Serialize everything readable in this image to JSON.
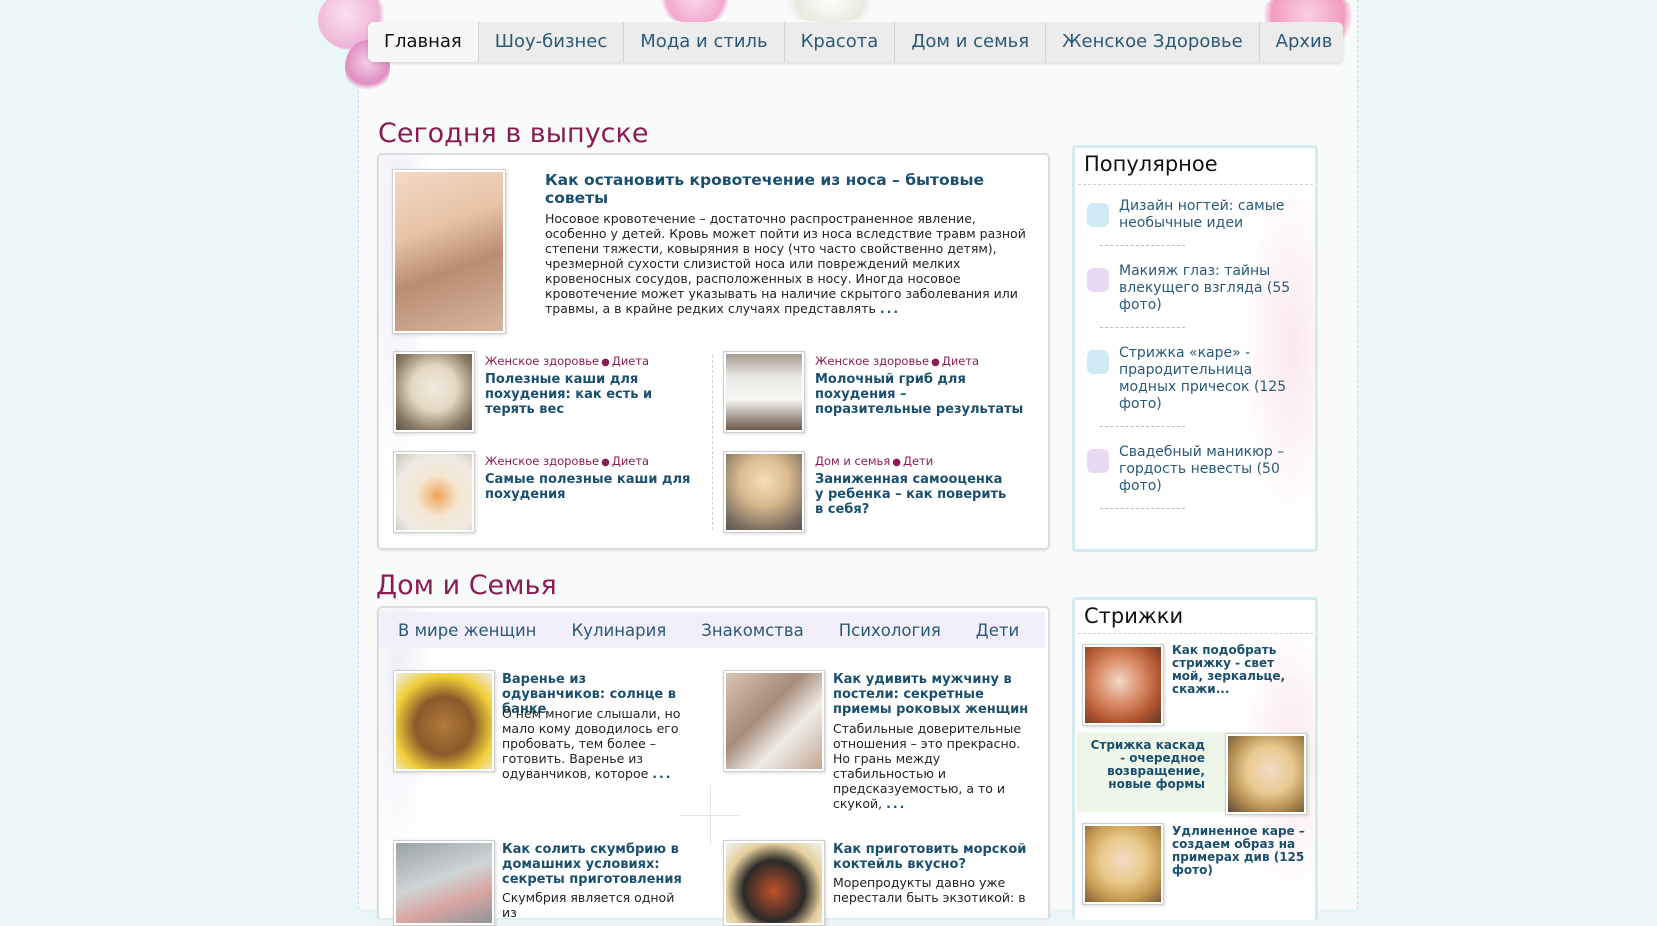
{
  "nav": {
    "items": [
      "Главная",
      "Шоу-бизнес",
      "Мода и стиль",
      "Красота",
      "Дом и семья",
      "Женское Здоровье",
      "Архив"
    ],
    "active": 0
  },
  "today": {
    "heading": "Сегодня в выпуске",
    "lead": {
      "title": "Как остановить кровотечение из носа – бытовые советы",
      "text": "Носовое кровотечение – достаточно распространенное явление, особенно у детей. Кровь может пойти из носа вследствие травм разной степени тяжести, ковыряния в носу (что часто свойственно детям), чрезмерной сухости слизистой носа или повреждений мелких кровеносных сосудов, расположенных в носу. Иногда носовое кровотечение может указывать на наличие скрытого заболевания или травмы, а в крайне редких случаях представлять",
      "more": "..."
    },
    "articles": [
      {
        "cat1": "Женское здоровье",
        "cat2": "Диета",
        "title": "Полезные каши для похудения: как есть и терять вес"
      },
      {
        "cat1": "Женское здоровье",
        "cat2": "Диета",
        "title": "Молочный гриб для похудения – поразительные результаты"
      },
      {
        "cat1": "Женское здоровье",
        "cat2": "Диета",
        "title": "Самые полезные каши для похудения"
      },
      {
        "cat1": "Дом и семья",
        "cat2": "Дети",
        "title": "Заниженная самооценка у ребенка – как поверить в себя?"
      }
    ]
  },
  "popular": {
    "heading": "Популярное",
    "items": [
      "Дизайн ногтей: самые необычные идеи",
      "Макияж глаз: тайны влекущего взгляда (55 фото)",
      "Стрижка «каре» - прародительница модных причесок (125 фото)",
      "Свадебный маникюр – гордость невесты (50 фото)"
    ]
  },
  "home": {
    "heading": "Дом и Семья",
    "tabs": [
      "В мире женщин",
      "Кулинария",
      "Знакомства",
      "Психология",
      "Дети"
    ],
    "articles": [
      {
        "title": "Варенье из одуванчиков: солнце в банке",
        "text": "О нем многие слышали, но мало кому доводилось его пробовать, тем более – готовить. Варенье из одуванчиков, которое",
        "more": "..."
      },
      {
        "title": "Как удивить мужчину в постели: секретные приемы роковых женщин",
        "text": "Стабильные доверительные отношения – это прекрасно. Но грань между стабильностью и предсказуемостью, а то и скукой,",
        "more": "..."
      },
      {
        "title": "Как солить скумбрию в домашних условиях: секреты приготовления",
        "text": "Скумбрия является одной из",
        "more": ""
      },
      {
        "title": "Как приготовить морской коктейль вкусно?",
        "text": "Морепродукты давно уже перестали быть экзотикой: в",
        "more": ""
      }
    ]
  },
  "haircuts": {
    "heading": "Стрижки",
    "items": [
      "Как подобрать стрижку - свет мой, зеркальце, скажи...",
      "Стрижка каскад - очередное возвращение, новые формы",
      "Удлиненное каре – создаем образ на примерах див (125 фото)"
    ]
  },
  "colors": {
    "accent": "#8a1c55",
    "link": "#1b4f6e",
    "nav_text": "#2a5a78",
    "page_bg": "#eaf6f8"
  }
}
